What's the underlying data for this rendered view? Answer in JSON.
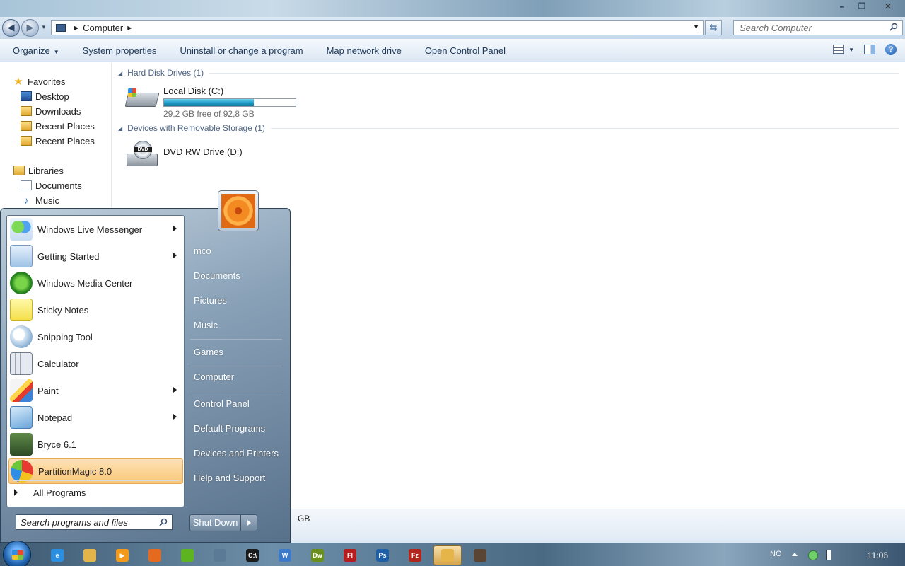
{
  "window": {
    "controls": [
      "–",
      "❐",
      "✕"
    ]
  },
  "address": {
    "crumb": "Computer",
    "search_placeholder": "Search Computer"
  },
  "toolbar": {
    "organize": "Organize",
    "system_properties": "System properties",
    "uninstall": "Uninstall or change a program",
    "map_network": "Map network drive",
    "control_panel": "Open Control Panel"
  },
  "navpane": {
    "favorites": "Favorites",
    "items": [
      "Desktop",
      "Downloads",
      "Recent Places",
      "Recent Places"
    ],
    "libraries": "Libraries",
    "lib_items": [
      "Documents",
      "Music"
    ]
  },
  "content": {
    "groups": [
      {
        "label": "Hard Disk Drives (1)"
      },
      {
        "label": "Devices with Removable Storage (1)"
      }
    ],
    "drives": [
      {
        "name": "Local Disk (C:)",
        "free": "29,2 GB free of 92,8 GB",
        "used_fraction": 0.685
      },
      {
        "name": "DVD RW Drive (D:)",
        "icon": "dvd-drive-icon"
      }
    ]
  },
  "details": {
    "text": "GB"
  },
  "startmenu": {
    "programs": [
      {
        "label": "Windows Live Messenger",
        "submenu": true
      },
      {
        "label": "Getting Started",
        "submenu": true
      },
      {
        "label": "Windows Media Center",
        "submenu": false
      },
      {
        "label": "Sticky Notes",
        "submenu": false
      },
      {
        "label": "Snipping Tool",
        "submenu": false
      },
      {
        "label": "Calculator",
        "submenu": false
      },
      {
        "label": "Paint",
        "submenu": true
      },
      {
        "label": "Notepad",
        "submenu": true
      },
      {
        "label": "Bryce 6.1",
        "submenu": false
      },
      {
        "label": "PartitionMagic 8.0",
        "submenu": false,
        "selected": true
      }
    ],
    "all_programs": "All Programs",
    "search_placeholder": "Search programs and files",
    "right_links": [
      "mco",
      "Documents",
      "Pictures",
      "Music",
      "Games",
      "Computer",
      "Control Panel",
      "Default Programs",
      "Devices and Printers",
      "Help and Support"
    ],
    "shutdown": "Shut Down"
  },
  "taskbar": {
    "pinned": [
      {
        "name": "internet-explorer-icon",
        "color": "#2a8fe0",
        "glyph": "e"
      },
      {
        "name": "explorer-icon",
        "color": "#e2b44a",
        "glyph": ""
      },
      {
        "name": "media-player-icon",
        "color": "#f29a1c",
        "glyph": "▶"
      },
      {
        "name": "firefox-icon",
        "color": "#e46a1f",
        "glyph": ""
      },
      {
        "name": "spotify-icon",
        "color": "#5cb520",
        "glyph": ""
      },
      {
        "name": "network-icon",
        "color": "#5a7a96",
        "glyph": ""
      },
      {
        "name": "cmd-icon",
        "color": "#1b1b1b",
        "glyph": "C:\\"
      },
      {
        "name": "writer-icon",
        "color": "#3c79c9",
        "glyph": "W"
      },
      {
        "name": "dreamweaver-icon",
        "color": "#6a8f1a",
        "glyph": "Dw"
      },
      {
        "name": "flash-icon",
        "color": "#b41d1d",
        "glyph": "Fl"
      },
      {
        "name": "photoshop-icon",
        "color": "#1f5fa6",
        "glyph": "Ps"
      },
      {
        "name": "filezilla-icon",
        "color": "#b3261e",
        "glyph": "Fz"
      },
      {
        "name": "computer-window-icon",
        "color": "#e6b54a",
        "glyph": ""
      },
      {
        "name": "misc-app-icon",
        "color": "#5a4534",
        "glyph": ""
      }
    ],
    "lang": "NO",
    "clock": "11:06"
  }
}
